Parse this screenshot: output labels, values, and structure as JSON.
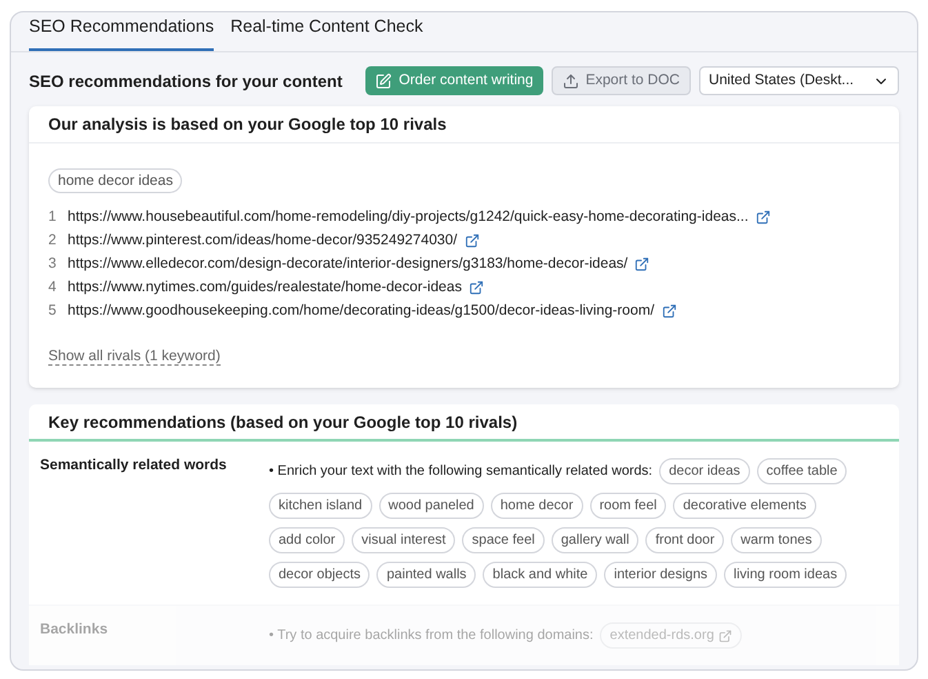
{
  "tabs": [
    {
      "label": "SEO Recommendations",
      "selected": true
    },
    {
      "label": "Real-time Content Check",
      "selected": false
    }
  ],
  "header": {
    "title": "SEO recommendations for your content",
    "order_button": "Order content writing",
    "export_button": "Export to DOC",
    "location_select": "United States (Deskt..."
  },
  "rivals_card": {
    "title": "Our analysis is based on your Google top 10 rivals",
    "keyword": "home decor ideas",
    "rivals": [
      {
        "number": "1",
        "url": "https://www.housebeautiful.com/home-remodeling/diy-projects/g1242/quick-easy-home-decorating-ideas..."
      },
      {
        "number": "2",
        "url": "https://www.pinterest.com/ideas/home-decor/935249274030/"
      },
      {
        "number": "3",
        "url": "https://www.elledecor.com/design-decorate/interior-designers/g3183/home-decor-ideas/"
      },
      {
        "number": "4",
        "url": "https://www.nytimes.com/guides/realestate/home-decor-ideas"
      },
      {
        "number": "5",
        "url": "https://www.goodhousekeeping.com/home/decorating-ideas/g1500/decor-ideas-living-room/"
      }
    ],
    "show_all_link": "Show all rivals (1 keyword)"
  },
  "recommendations_card": {
    "title": "Key recommendations (based on your Google top 10 rivals)",
    "sections": [
      {
        "label": "Semantically related words",
        "dimmed": false,
        "text": "• Enrich your text with the following semantically related words:",
        "tags": [
          {
            "text": "decor ideas",
            "link": false
          },
          {
            "text": "coffee table",
            "link": false
          },
          {
            "text": "kitchen island",
            "link": false
          },
          {
            "text": "wood paneled",
            "link": false
          },
          {
            "text": "home decor",
            "link": false
          },
          {
            "text": "room feel",
            "link": false
          },
          {
            "text": "decorative elements",
            "link": false
          },
          {
            "text": "add color",
            "link": false
          },
          {
            "text": "visual interest",
            "link": false
          },
          {
            "text": "space feel",
            "link": false
          },
          {
            "text": "gallery wall",
            "link": false
          },
          {
            "text": "front door",
            "link": false
          },
          {
            "text": "warm tones",
            "link": false
          },
          {
            "text": "decor objects",
            "link": false
          },
          {
            "text": "painted walls",
            "link": false
          },
          {
            "text": "black and white",
            "link": false
          },
          {
            "text": "interior designs",
            "link": false
          },
          {
            "text": "living room ideas",
            "link": false
          }
        ]
      },
      {
        "label": "Backlinks",
        "dimmed": true,
        "text": "• Try to acquire backlinks from the following domains:",
        "tags": [
          {
            "text": "extended-rds.org",
            "link": true
          }
        ]
      }
    ]
  }
}
